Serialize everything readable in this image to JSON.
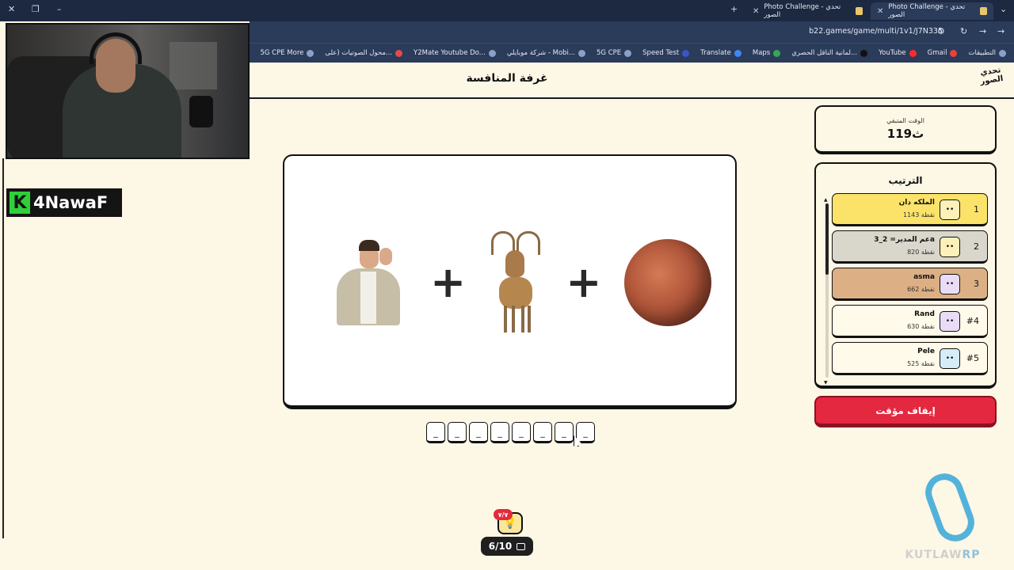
{
  "browser": {
    "tabs": [
      {
        "title": "Photo Challenge - تحدي الصور",
        "active": true
      },
      {
        "title": "Photo Challenge - تحدي الصور",
        "active": false
      }
    ],
    "url": "b22.games/game/multi/1v1/J7N335",
    "bookmarks": [
      "التطبيقات",
      "Gmail",
      "YouTube",
      "لمانية الناقل الحصري...",
      "Maps",
      "Translate",
      "Speed Test",
      "5G CPE",
      "شركة موبايلي - Mobi...",
      "Y2Mate Youtube Do...",
      "محول الصوتيات (على...",
      "5G CPE More"
    ]
  },
  "stream": {
    "channel_initial": "K",
    "channel_name": "4NawaF"
  },
  "game": {
    "room_title": "غرفة المنافسة",
    "brand": "تحدي الصور",
    "timer": {
      "label": "الوقت المتبقي",
      "value": "119ث"
    },
    "ranking_title": "الترتيب",
    "players": [
      {
        "rank": "1",
        "name": "الملكه دان",
        "score": "1143 نقطة",
        "color": "#fbe36a"
      },
      {
        "rank": "2",
        "name": "عم المدير= 2_3a",
        "score": "820 نقطة",
        "color": "#d9d6cc"
      },
      {
        "rank": "3",
        "name": "asma",
        "score": "662 نقطة",
        "color": "#dcb084"
      },
      {
        "rank": "#4",
        "name": "Rand",
        "score": "630 نقطة",
        "color": "#fffaea"
      },
      {
        "rank": "#5",
        "name": "Pele",
        "score": "525 نقطة",
        "color": "#fffaea"
      }
    ],
    "stop_button": "إيقاف مؤقت",
    "puzzle_icons": [
      "man-calling-image",
      "plus-icon",
      "deer-image",
      "plus-icon",
      "mars-planet-image"
    ],
    "answer_slots": [
      "_",
      "_",
      "_",
      "_",
      "_",
      "_",
      "_",
      "_"
    ],
    "hint_badge": "٧/٧",
    "progress": "6/10"
  },
  "watermark": {
    "text_a": "KUTLAW",
    "text_b": "RP"
  },
  "colors": {
    "accent_red": "#e4283f",
    "background": "#fdf7e6",
    "gold": "#fbe36a"
  }
}
